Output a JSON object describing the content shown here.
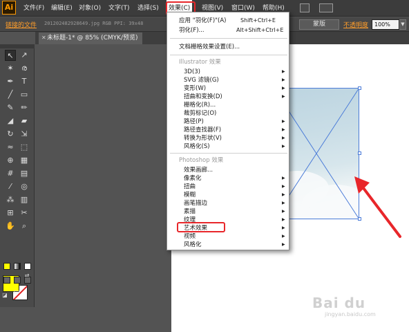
{
  "app": {
    "logo": "Ai"
  },
  "menubar": {
    "items": [
      "文件(F)",
      "编辑(E)",
      "对象(O)",
      "文字(T)",
      "选择(S)",
      "效果(C)",
      "视图(V)",
      "窗口(W)",
      "帮助(H)"
    ],
    "active": "效果(C)"
  },
  "controlbar": {
    "link_label": "链接的文件",
    "file_info": "20120248292864​9.jpg  RGB  PPI: 39x48",
    "mask_button": "蒙版",
    "opacity_label": "不透明度",
    "opacity_value": "100%"
  },
  "document": {
    "tab_title": "未标题-1* @ 85% (CMYK/预览)"
  },
  "effect_menu": {
    "apply_last": {
      "label": "应用 \"羽化(F)\"(A)",
      "shortcut": "Shift+Ctrl+E"
    },
    "last_effect": {
      "label": "羽化(F)...",
      "shortcut": "Alt+Shift+Ctrl+E"
    },
    "raster_settings": "文档栅格效果设置(E)...",
    "illustrator_header": "Illustrator 效果",
    "illustrator_items": [
      "3D(3)",
      "SVG 滤镜(G)",
      "变形(W)",
      "扭曲和变换(D)",
      "栅格化(R)...",
      "裁剪标记(O)",
      "路径(P)",
      "路径查找器(F)",
      "转换为形状(V)",
      "风格化(S)"
    ],
    "photoshop_header": "Photoshop 效果",
    "photoshop_items": [
      "效果画廊...",
      "像素化",
      "扭曲",
      "模糊",
      "画笔描边",
      "素描",
      "纹理",
      "艺术效果",
      "视频",
      "风格化"
    ],
    "highlighted": "艺术效果"
  },
  "watermark": {
    "brand": "Bai du",
    "sub": "jingyan.baidu.com"
  },
  "colors": {
    "menu_highlight": "#e8262a",
    "fill_swatch": "#ffff00",
    "accent_orange": "#ff9d2a",
    "selection": "#4a7bd8"
  }
}
